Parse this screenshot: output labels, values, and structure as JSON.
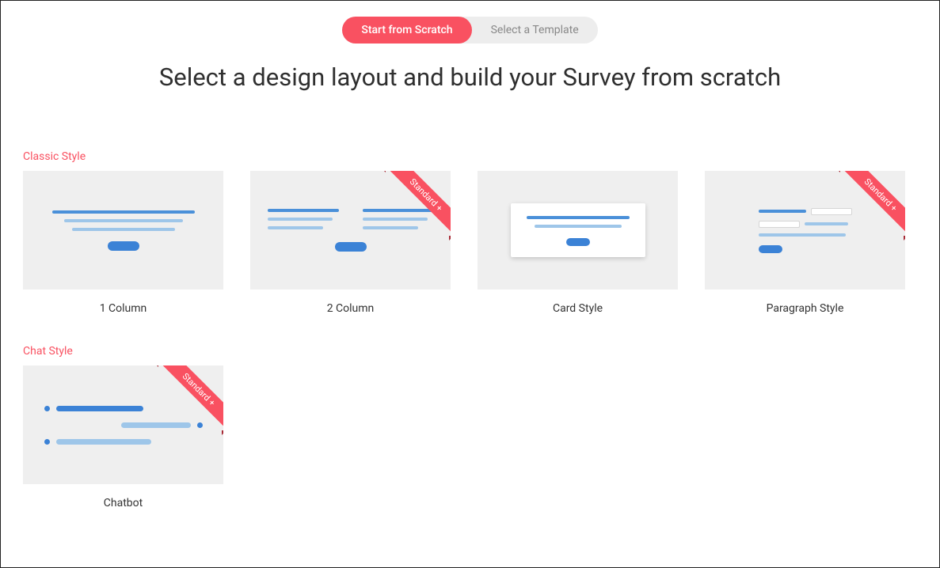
{
  "toggle": {
    "left": "Start from Scratch",
    "right": "Select a Template"
  },
  "page_title": "Select a design layout and build your Survey from scratch",
  "ribbon_text": "Standard +",
  "sections": {
    "classic": {
      "label": "Classic Style",
      "cards": {
        "one_column": "1 Column",
        "two_column": "2 Column",
        "card_style": "Card Style",
        "paragraph_style": "Paragraph Style"
      }
    },
    "chat": {
      "label": "Chat Style",
      "cards": {
        "chatbot": "Chatbot"
      }
    }
  }
}
